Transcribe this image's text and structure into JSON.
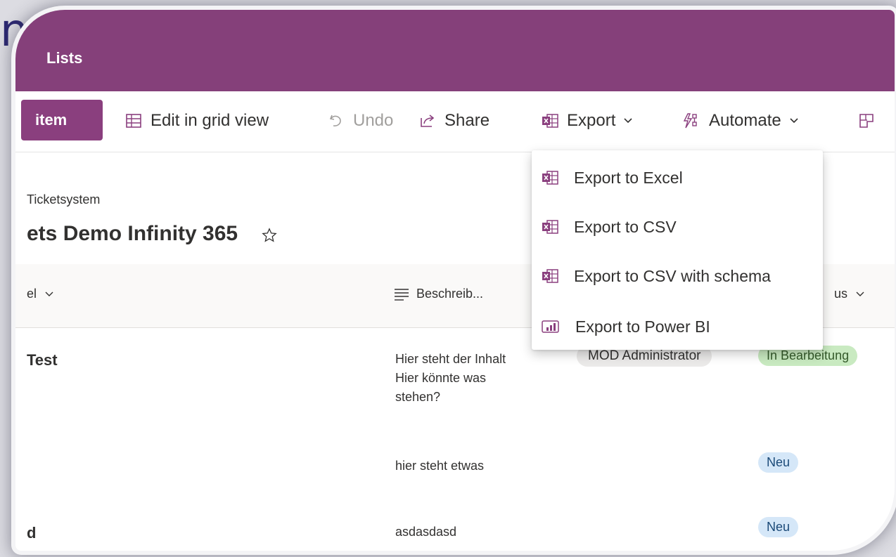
{
  "page": {
    "left_fragment": "n"
  },
  "appbar": {
    "title": "Lists"
  },
  "commandbar": {
    "new_label": "item",
    "edit_grid": "Edit in grid view",
    "undo": "Undo",
    "share": "Share",
    "export": "Export",
    "automate": "Automate"
  },
  "list": {
    "breadcrumb": "Ticketsystem",
    "title": "ets Demo Infinity 365"
  },
  "columns": {
    "title": "el",
    "description": "Beschreib...",
    "status": "us"
  },
  "rows": [
    {
      "title": "Test",
      "description": "Hier steht der Inhalt\nHier könnte was\nstehen?",
      "assigned": "MOD Administrator",
      "status": "In Bearbeitung"
    },
    {
      "title": "",
      "description": "hier steht etwas",
      "assigned": "",
      "status": "Neu"
    },
    {
      "title": "d",
      "description": "asdasdasd",
      "assigned": "",
      "status": "Neu"
    }
  ],
  "export_menu": {
    "items": [
      {
        "label": "Export to Excel",
        "icon": "excel-icon"
      },
      {
        "label": "Export to CSV",
        "icon": "excel-icon"
      },
      {
        "label": "Export to CSV with schema",
        "icon": "excel-icon"
      },
      {
        "label": "Export to Power BI",
        "icon": "powerbi-icon"
      }
    ]
  },
  "colors": {
    "appbar": "#85407a",
    "new_button": "#8a3f7e",
    "status_green": "#c9eac1",
    "status_blue": "#d5e7f8"
  }
}
